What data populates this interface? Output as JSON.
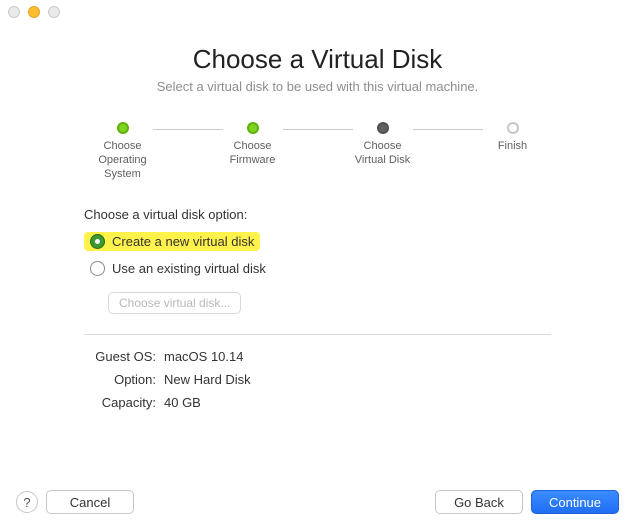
{
  "header": {
    "title": "Choose a Virtual Disk",
    "subtitle": "Select a virtual disk to be used with this virtual machine."
  },
  "stepper": {
    "steps": [
      {
        "label": "Choose\nOperating\nSystem",
        "state": "done"
      },
      {
        "label": "Choose\nFirmware",
        "state": "done"
      },
      {
        "label": "Choose\nVirtual Disk",
        "state": "current"
      },
      {
        "label": "Finish",
        "state": "future"
      }
    ]
  },
  "options": {
    "prompt": "Choose a virtual disk option:",
    "radios": [
      {
        "label": "Create a new virtual disk",
        "selected": true,
        "highlighted": true
      },
      {
        "label": "Use an existing virtual disk",
        "selected": false,
        "highlighted": false
      }
    ],
    "choose_button": "Choose virtual disk...",
    "choose_button_enabled": false
  },
  "summary": {
    "rows": [
      {
        "key": "Guest OS:",
        "val": "macOS 10.14"
      },
      {
        "key": "Option:",
        "val": "New Hard Disk"
      },
      {
        "key": "Capacity:",
        "val": "40 GB"
      }
    ]
  },
  "buttons": {
    "help": "?",
    "cancel": "Cancel",
    "go_back": "Go Back",
    "continue": "Continue"
  }
}
